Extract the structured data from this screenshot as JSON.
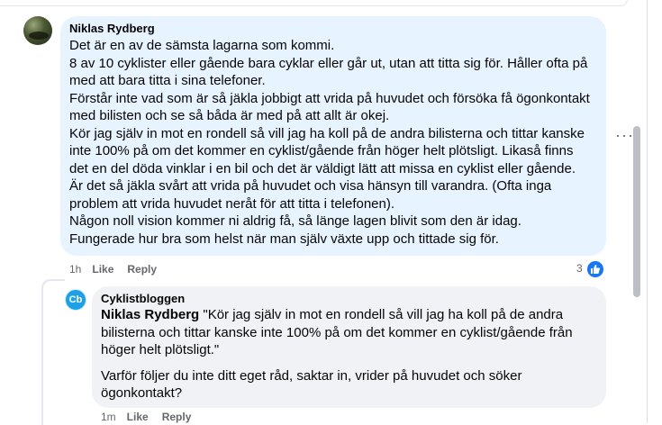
{
  "comment": {
    "author": "Niklas Rydberg",
    "lines": [
      "Det är en av de sämsta lagarna som kommi.",
      "8 av 10 cyklister eller gående bara cyklar eller går ut, utan att titta sig för. Håller ofta på",
      "med att bara titta i sina telefoner.",
      "Förstår inte vad som är så jäkla jobbigt att vrida på huvudet och försöka få ögonkontakt",
      "med bilisten och se så båda är med på att allt är okej.",
      "Kör jag själv in mot en rondell så vill jag ha koll på de andra bilisterna och tittar kanske",
      "inte 100% på om det kommer en cyklist/gående från höger helt plötsligt. Likaså finns",
      "det en del döda vinklar i en bil och det är väldigt lätt att missa en cyklist eller gående.",
      "Är det så jäkla svårt att vrida på huvudet och visa hänsyn till varandra. (Ofta inga",
      "problem att vrida huvudet neråt för att titta i telefonen).",
      "Någon noll vision kommer ni aldrig få, så länge lagen blivit som den är idag.",
      "Fungerade hur bra som helst när man själv växte upp och tittade sig för."
    ],
    "time": "1h",
    "like_label": "Like",
    "reply_label": "Reply",
    "reaction_count": "3",
    "reaction_icon": "thumbs-up-icon",
    "more_options": "···"
  },
  "reply": {
    "author": "Cyklistbloggen",
    "avatar_text": "Cb",
    "mention": "Niklas Rydberg",
    "quote_first": " \"Kör jag själv in mot en rondell så vill jag ha koll på de andra",
    "quote_lines": [
      "bilisterna och tittar kanske inte 100% på om det kommer en cyklist/gående från",
      "höger helt plötsligt.\""
    ],
    "question_lines": [
      "Varför följer du inte ditt eget råd, saktar in, vrider på huvudet och söker",
      "ögonkontakt?"
    ],
    "time": "1m",
    "like_label": "Like",
    "reply_label": "Reply"
  },
  "colors": {
    "comment_bubble": "#e7f3ff",
    "reply_bubble": "#f0f2f5",
    "like_blue": "#1877f2",
    "brand_avatar": "#1ca1e6",
    "meta_gray": "#65676b"
  }
}
